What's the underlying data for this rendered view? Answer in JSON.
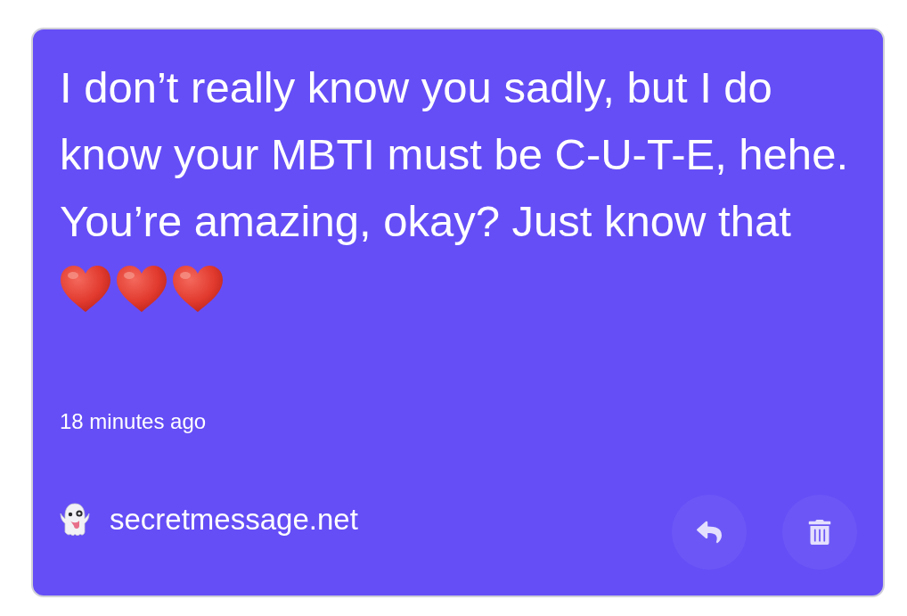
{
  "message": {
    "text": "I don’t really know you sadly, but I do know your MBTI must be C-U-T-E, hehe. You’re amazing, okay? Just know that"
  },
  "timestamp": "18 minutes ago",
  "footer": {
    "site": "secretmessage.net"
  }
}
